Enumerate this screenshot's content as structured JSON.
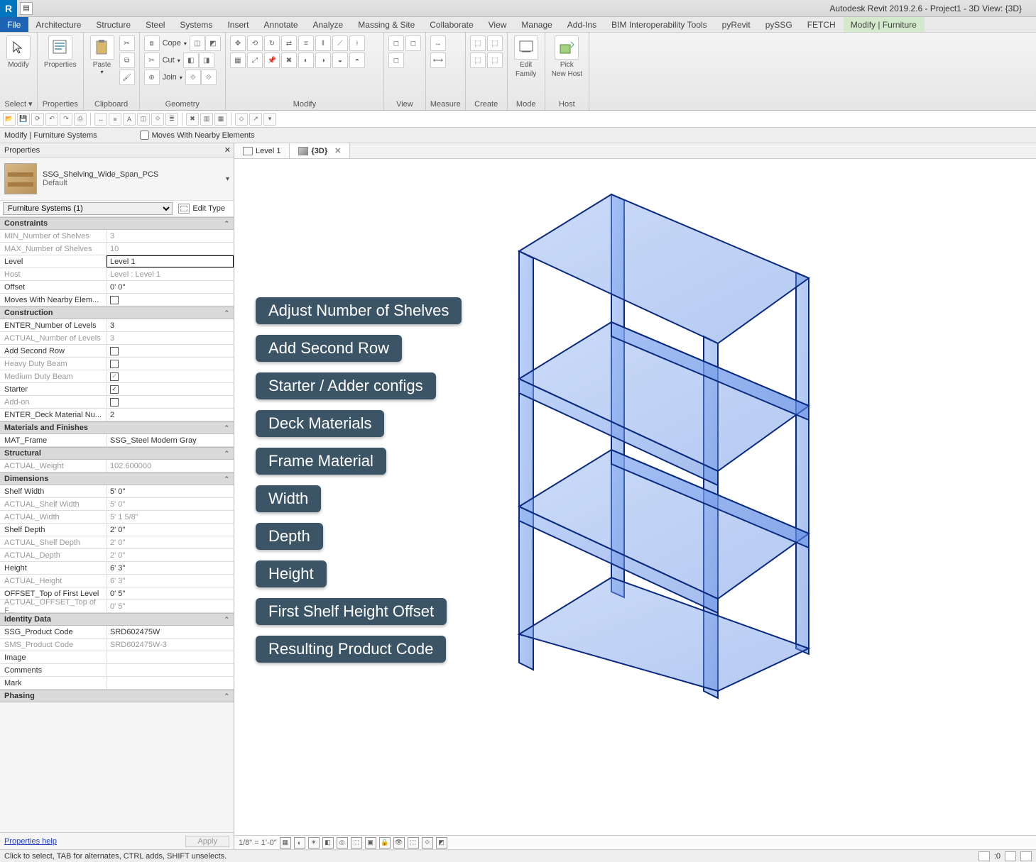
{
  "app": {
    "title": "Autodesk Revit 2019.2.6 - Project1 - 3D View: {3D}"
  },
  "menu": {
    "file": "File",
    "tabs": [
      "Architecture",
      "Structure",
      "Steel",
      "Systems",
      "Insert",
      "Annotate",
      "Analyze",
      "Massing & Site",
      "Collaborate",
      "View",
      "Manage",
      "Add-Ins",
      "BIM Interoperability Tools",
      "pyRevit",
      "pySSG",
      "FETCH",
      "Modify | Furniture"
    ]
  },
  "ribbon": {
    "panels": {
      "select": {
        "modify": "Modify",
        "title": "Select ▾"
      },
      "properties": {
        "label": "Properties",
        "title": "Properties"
      },
      "clipboard": {
        "label": "Paste",
        "title": "Clipboard"
      },
      "geometry": {
        "cope": "Cope",
        "cut": "Cut",
        "join": "Join",
        "title": "Geometry"
      },
      "modify": {
        "title": "Modify"
      },
      "view": {
        "title": "View"
      },
      "measure": {
        "title": "Measure"
      },
      "create": {
        "title": "Create"
      },
      "mode": {
        "edit_family_1": "Edit",
        "edit_family_2": "Family",
        "title": "Mode"
      },
      "host": {
        "pick_1": "Pick",
        "pick_2": "New Host",
        "title": "Host"
      }
    }
  },
  "optionBar": {
    "context": "Modify | Furniture Systems",
    "moves_label": "Moves With Nearby Elements"
  },
  "props": {
    "title": "Properties",
    "type_name": "SSG_Shelving_Wide_Span_PCS",
    "type_default": "Default",
    "instance_label": "Furniture Systems (1)",
    "edit_type_label": "Edit Type",
    "groups": {
      "constraints": {
        "title": "Constraints",
        "rows": [
          {
            "label": "MIN_Number of Shelves",
            "value": "3",
            "dim": true
          },
          {
            "label": "MAX_Number of Shelves",
            "value": "10",
            "dim": true
          },
          {
            "label": "Level",
            "value": "Level 1",
            "active": true
          },
          {
            "label": "Host",
            "value": "Level : Level 1",
            "dim": true
          },
          {
            "label": "Offset",
            "value": "0'  0\""
          },
          {
            "label": "Moves With Nearby Elem...",
            "value": "",
            "check": false
          }
        ]
      },
      "construction": {
        "title": "Construction",
        "rows": [
          {
            "label": "ENTER_Number of Levels",
            "value": "3"
          },
          {
            "label": "ACTUAL_Number of Levels",
            "value": "3",
            "dim": true
          },
          {
            "label": "Add Second Row",
            "value": "",
            "check": false
          },
          {
            "label": "Heavy Duty Beam",
            "value": "",
            "check": false,
            "dim": true
          },
          {
            "label": "Medium Duty Beam",
            "value": "",
            "check": true,
            "dim": true
          },
          {
            "label": "Starter",
            "value": "",
            "check": true
          },
          {
            "label": "Add-on",
            "value": "",
            "check": false,
            "dim": true
          },
          {
            "label": "ENTER_Deck Material Nu...",
            "value": "2"
          }
        ]
      },
      "materials": {
        "title": "Materials and Finishes",
        "rows": [
          {
            "label": "MAT_Frame",
            "value": "SSG_Steel Modern Gray"
          }
        ]
      },
      "structural": {
        "title": "Structural",
        "rows": [
          {
            "label": "ACTUAL_Weight",
            "value": "102.600000",
            "dim": true
          }
        ]
      },
      "dimensions": {
        "title": "Dimensions",
        "rows": [
          {
            "label": "Shelf Width",
            "value": "5'  0\""
          },
          {
            "label": "ACTUAL_Shelf Width",
            "value": "5'  0\"",
            "dim": true
          },
          {
            "label": "ACTUAL_Width",
            "value": "5'  1 5/8\"",
            "dim": true
          },
          {
            "label": "Shelf Depth",
            "value": "2'  0\""
          },
          {
            "label": "ACTUAL_Shelf Depth",
            "value": "2'  0\"",
            "dim": true
          },
          {
            "label": "ACTUAL_Depth",
            "value": "2'  0\"",
            "dim": true
          },
          {
            "label": "Height",
            "value": "6'  3\""
          },
          {
            "label": "ACTUAL_Height",
            "value": "6'  3\"",
            "dim": true
          },
          {
            "label": "OFFSET_Top of First Level",
            "value": "0'  5\""
          },
          {
            "label": "ACTUAL_OFFSET_Top of F...",
            "value": "0'  5\"",
            "dim": true
          }
        ]
      },
      "identity": {
        "title": "Identity Data",
        "rows": [
          {
            "label": "SSG_Product Code",
            "value": "SRD602475W"
          },
          {
            "label": "SMS_Product Code",
            "value": "SRD602475W-3",
            "dim": true
          },
          {
            "label": "Image",
            "value": ""
          },
          {
            "label": "Comments",
            "value": ""
          },
          {
            "label": "Mark",
            "value": ""
          }
        ]
      },
      "phasing": {
        "title": "Phasing"
      }
    },
    "help": "Properties help",
    "apply": "Apply"
  },
  "viewtabs": {
    "level1": "Level 1",
    "threeD": "{3D}"
  },
  "annotations": {
    "shelves": "Adjust Number of Shelves",
    "second_row": "Add Second Row",
    "starter": "Starter / Adder configs",
    "deck": "Deck Materials",
    "frame": "Frame Material",
    "width": "Width",
    "depth": "Depth",
    "height": "Height",
    "offset": "First Shelf Height Offset",
    "product": "Resulting Product Code"
  },
  "viewbar": {
    "scale": "1/8\" = 1'-0\""
  },
  "status": {
    "hint": "Click to select, TAB for alternates, CTRL adds, SHIFT unselects.",
    "count": ":0"
  }
}
